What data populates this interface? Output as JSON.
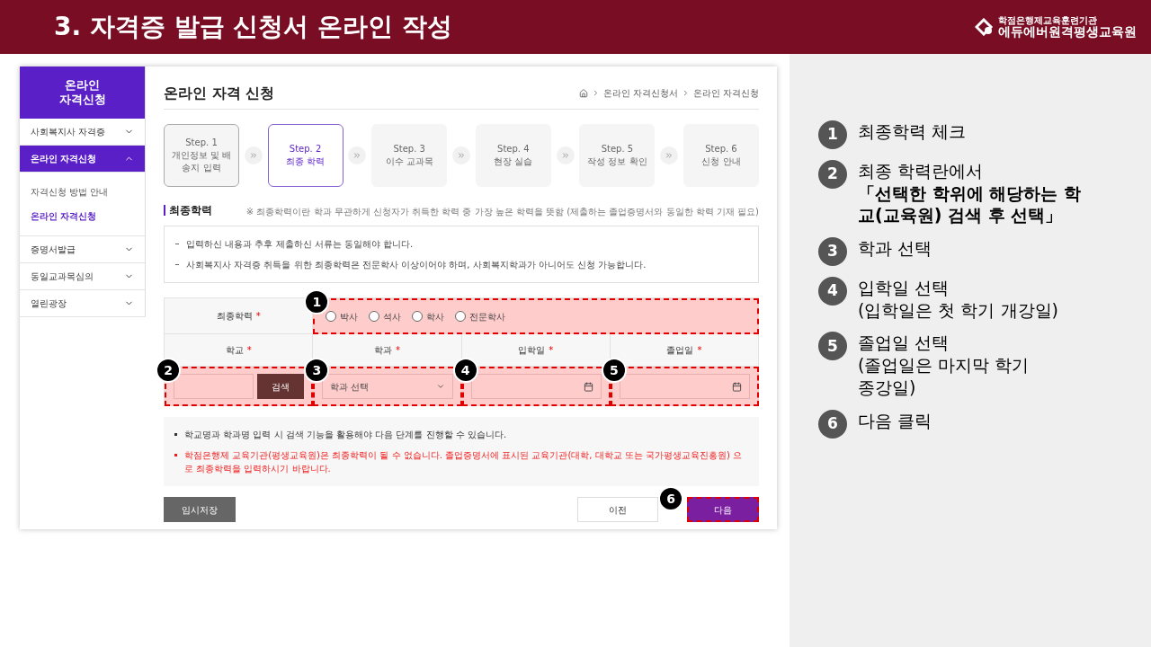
{
  "slide_title": "3. 자격증 발급 신청서 온라인 작성",
  "logo": {
    "tagline": "학점은행제교육훈련기관",
    "name": "에듀에버원격평생교육원"
  },
  "sidebar": {
    "title_lines": [
      "온라인",
      "자격신청"
    ],
    "items": [
      {
        "label": "사회복지사 자격증",
        "selected": false,
        "expanded": false
      },
      {
        "label": "온라인 자격신청",
        "selected": true,
        "expanded": true,
        "children": [
          {
            "label": "자격신청 방법 안내",
            "selected": false
          },
          {
            "label": "온라인 자격신청",
            "selected": true
          }
        ]
      },
      {
        "label": "증명서발급",
        "selected": false,
        "expanded": false
      },
      {
        "label": "동일교과목심의",
        "selected": false,
        "expanded": false
      },
      {
        "label": "열린광장",
        "selected": false,
        "expanded": false
      }
    ]
  },
  "page": {
    "title": "온라인 자격 신청",
    "breadcrumb": [
      "온라인 자격신청서",
      "온라인 자격신청"
    ],
    "steps": [
      {
        "step": "Step. 1",
        "name": "개인정보 및 배송지 입력",
        "selected": false,
        "completed": true
      },
      {
        "step": "Step. 2",
        "name": "최종 학력",
        "selected": true,
        "completed": false
      },
      {
        "step": "Step. 3",
        "name": "이수 교과목",
        "selected": false,
        "completed": false
      },
      {
        "step": "Step. 4",
        "name": "현장 실습",
        "selected": false,
        "completed": false
      },
      {
        "step": "Step. 5",
        "name": "작성 정보 확인",
        "selected": false,
        "completed": false
      },
      {
        "step": "Step. 6",
        "name": "신청 안내",
        "selected": false,
        "completed": false
      }
    ],
    "section_title": "최종학력",
    "section_note": "※ 최종학력이란 학과 무관하게 신청자가 취득한 학력 중 가장 높은 학력을 뜻함 (제출하는 졸업증명서와 동일한 학력 기재 필요)",
    "notices": [
      "입력하신 내용과 추후 제출하신 서류는 동일해야 합니다.",
      "사회복지사 자격증 취득을 위한 최종학력은 전문학사 이상이어야 하며, 사회복지학과가 아니어도 신청 가능합니다."
    ],
    "form": {
      "degree": {
        "label": "최종학력",
        "required_mark": "*",
        "marker": "1",
        "options": [
          {
            "label": "박사",
            "selected": false
          },
          {
            "label": "석사",
            "selected": false
          },
          {
            "label": "학사",
            "selected": false
          },
          {
            "label": "전문학사",
            "selected": false
          }
        ]
      },
      "school": {
        "label": "학교",
        "required_mark": "*",
        "marker": "2",
        "button": "검색"
      },
      "department": {
        "label": "학과",
        "required_mark": "*",
        "marker": "3",
        "placeholder": "학과 선택"
      },
      "admission": {
        "label": "입학일",
        "required_mark": "*",
        "marker": "4"
      },
      "graduation": {
        "label": "졸업일",
        "required_mark": "*",
        "marker": "5"
      }
    },
    "tips": [
      {
        "kind": "normal",
        "text": "학교명과 학과명 입력 시 검색 기능을 활용해야 다음 단계를 진행할 수 있습니다."
      },
      {
        "kind": "warning",
        "text": "학점은행제 교육기관(평생교육원)은 최종학력이 될 수 없습니다. 졸업증명서에 표시된 교육기관(대학, 대학교 또는 국가평생교육진흥원) 으로 최종학력을 입력하시기 바랍니다."
      }
    ],
    "buttons": {
      "save": "임시저장",
      "prev": "이전",
      "next": "다음",
      "next_marker": "6"
    }
  },
  "callouts": [
    {
      "number": "1",
      "text": "최종학력 체크"
    },
    {
      "number": "2",
      "text": "최종 학력란에서\n**「선택한 학위에 해당하는 학교(교육원) 검색 후 선택」**"
    },
    {
      "number": "3",
      "text": "학과 선택"
    },
    {
      "number": "4",
      "text": "입학일 선택\n(입학일은 첫 학기 개강일)"
    },
    {
      "number": "5",
      "text": "졸업일 선택\n(졸업일은 마지막 학기\n종강일)"
    },
    {
      "number": "6",
      "text": "다음 클릭"
    }
  ]
}
